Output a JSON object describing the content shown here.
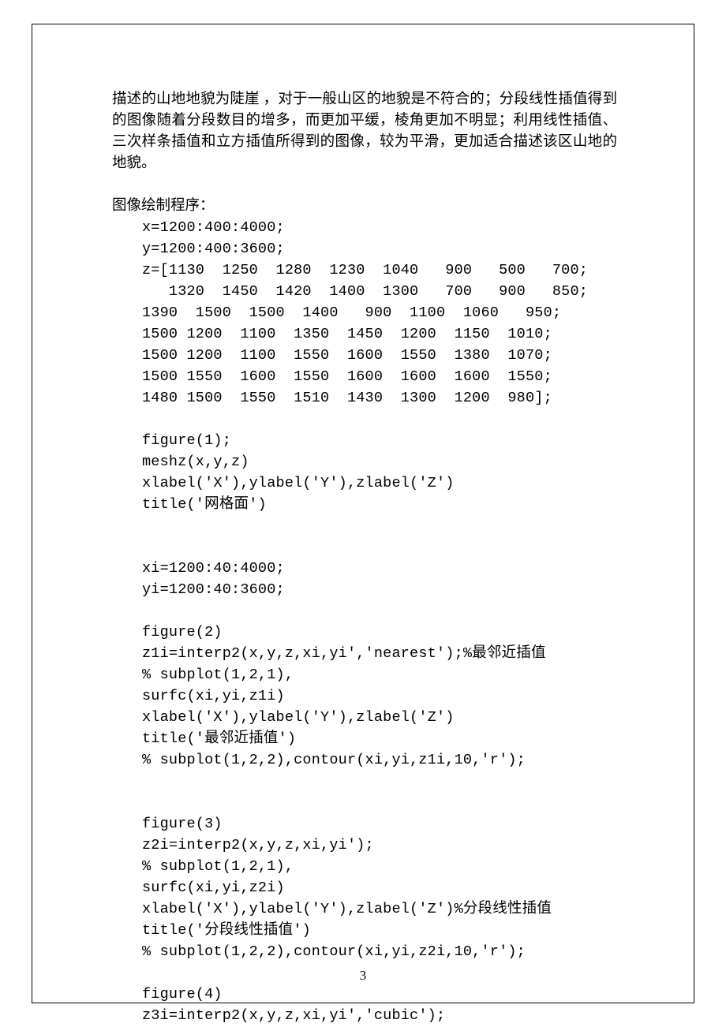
{
  "paragraph": "描述的山地地貌为陡崖 ，对于一般山区的地貌是不符合的；分段线性插值得到的图像随着分段数目的增多，而更加平缓，棱角更加不明显；利用线性插值、三次样条插值和立方插值所得到的图像，较为平滑，更加适合描述该区山地的地貌。",
  "section_label": "图像绘制程序：",
  "code": "x=1200:400:4000;\ny=1200:400:3600;\nz=[1130  1250  1280  1230  1040   900   500   700;\n   1320  1450  1420  1400  1300   700   900   850;\n1390  1500  1500  1400   900  1100  1060   950;\n1500 1200  1100  1350  1450  1200  1150  1010;\n1500 1200  1100  1550  1600  1550  1380  1070;\n1500 1550  1600  1550  1600  1600  1600  1550;\n1480 1500  1550  1510  1430  1300  1200  980];\n\nfigure(1);\nmeshz(x,y,z)\nxlabel('X'),ylabel('Y'),zlabel('Z')\ntitle('网格面')\n\n\nxi=1200:40:4000;\nyi=1200:40:3600;\n\nfigure(2)\nz1i=interp2(x,y,z,xi,yi','nearest');%最邻近插值\n% subplot(1,2,1),\nsurfc(xi,yi,z1i)\nxlabel('X'),ylabel('Y'),zlabel('Z')\ntitle('最邻近插值')\n% subplot(1,2,2),contour(xi,yi,z1i,10,'r');\n\n\nfigure(3)\nz2i=interp2(x,y,z,xi,yi');\n% subplot(1,2,1),\nsurfc(xi,yi,z2i)\nxlabel('X'),ylabel('Y'),zlabel('Z')%分段线性插值\ntitle('分段线性插值')\n% subplot(1,2,2),contour(xi,yi,z2i,10,'r');\n\nfigure(4)\nz3i=interp2(x,y,z,xi,yi','cubic');",
  "page_number": "3"
}
